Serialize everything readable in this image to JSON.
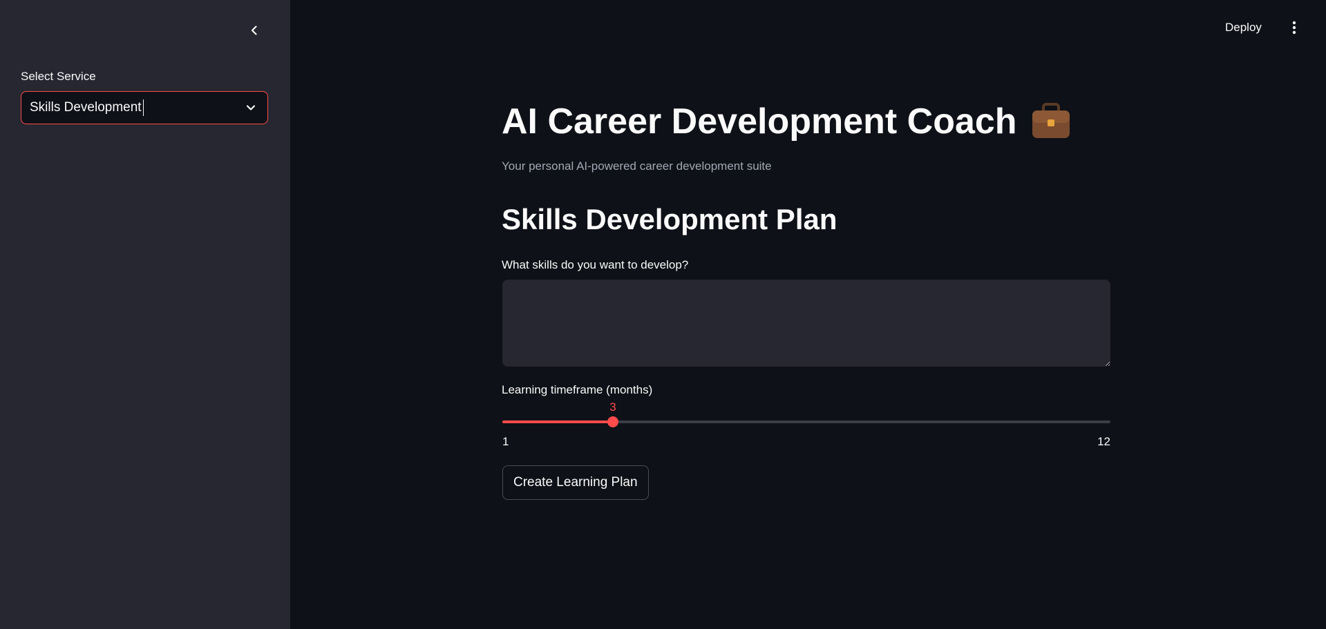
{
  "sidebar": {
    "select_label": "Select Service",
    "select_value": "Skills Development"
  },
  "topbar": {
    "deploy_label": "Deploy"
  },
  "main": {
    "title": "AI Career Development Coach",
    "title_emoji": "briefcase-icon",
    "subtitle": "Your personal AI-powered career development suite",
    "section_title": "Skills Development Plan",
    "skills_label": "What skills do you want to develop?",
    "skills_value": "",
    "timeframe_label": "Learning timeframe (months)",
    "timeframe": {
      "min": "1",
      "max": "12",
      "value": "3"
    },
    "submit_label": "Create Learning Plan"
  },
  "colors": {
    "background": "#0e1117",
    "sidebar": "#262730",
    "accent": "#ff4b4b",
    "muted_text": "#a3a8b4"
  }
}
